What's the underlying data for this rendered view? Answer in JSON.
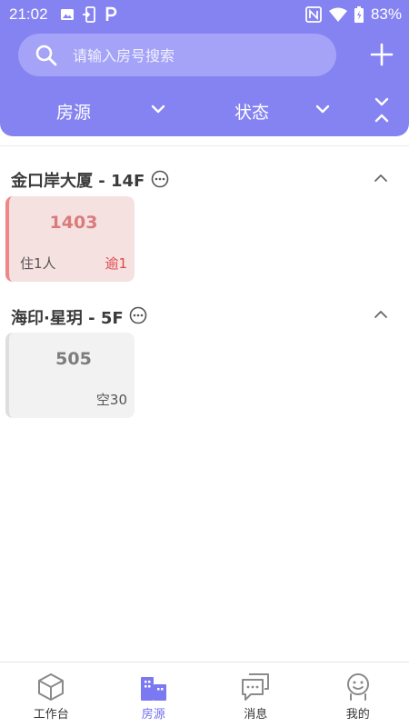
{
  "status_bar": {
    "time": "21:02",
    "battery": "83%"
  },
  "search": {
    "placeholder": "请输入房号搜索"
  },
  "filters": {
    "house": "房源",
    "status": "状态"
  },
  "groups": [
    {
      "title": "金口岸大厦 - 14F",
      "rooms": [
        {
          "number": "1403",
          "left": "住1人",
          "right": "逾1"
        }
      ]
    },
    {
      "title": "海印·星玥 - 5F",
      "rooms": [
        {
          "number": "505",
          "left": "",
          "right": "空30"
        }
      ]
    }
  ],
  "tabs": [
    {
      "label": "工作台",
      "icon": "cube-icon"
    },
    {
      "label": "房源",
      "icon": "buildings-icon",
      "active": true
    },
    {
      "label": "消息",
      "icon": "message-icon"
    },
    {
      "label": "我的",
      "icon": "person-icon"
    }
  ],
  "colors": {
    "accent": "#8583f2",
    "overdue": "#e04747"
  }
}
